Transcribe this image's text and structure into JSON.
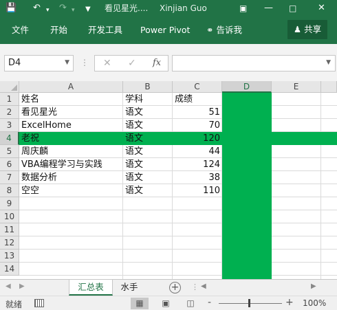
{
  "titlebar": {
    "file_title": "看见星光....",
    "user": "Xinjian Guo",
    "icons": {
      "save": "save-icon",
      "undo": "undo-icon",
      "redo": "redo-icon",
      "customize": "customize-qat-icon",
      "ribbon_options": "ribbon-display-options-icon",
      "minimize": "minimize-icon",
      "maximize": "maximize-icon",
      "close": "close-icon"
    }
  },
  "ribbon": {
    "tabs": [
      "文件",
      "开始",
      "开发工具",
      "Power Pivot"
    ],
    "tell_me": "告诉我",
    "share": "共享"
  },
  "formula_bar": {
    "name_box": "D4",
    "formula": "",
    "fx_label": "fx"
  },
  "grid": {
    "columns": [
      "A",
      "B",
      "C",
      "D",
      "E"
    ],
    "rows": [
      "1",
      "2",
      "3",
      "4",
      "5",
      "6",
      "7",
      "8",
      "9",
      "10",
      "11",
      "12",
      "13",
      "14"
    ],
    "active_cell": "D4",
    "highlight_color": "#00b050",
    "cells": [
      [
        "姓名",
        "学科",
        "成绩"
      ],
      [
        "看见星光",
        "语文",
        "51"
      ],
      [
        "ExcelHome",
        "语文",
        "70"
      ],
      [
        "老祝",
        "语文",
        "120"
      ],
      [
        "周庆麟",
        "语文",
        "44"
      ],
      [
        "VBA编程学习与实践",
        "语文",
        "124"
      ],
      [
        "数据分析",
        "语文",
        "38"
      ],
      [
        "空空",
        "语文",
        "110"
      ]
    ]
  },
  "sheets": {
    "tabs": [
      "汇总表",
      "水手"
    ],
    "active": "汇总表"
  },
  "status": {
    "ready": "就绪",
    "zoom": "100%",
    "zoom_minus": "-",
    "zoom_plus": "+"
  },
  "colors": {
    "brand": "#217346",
    "highlight": "#00b050"
  }
}
